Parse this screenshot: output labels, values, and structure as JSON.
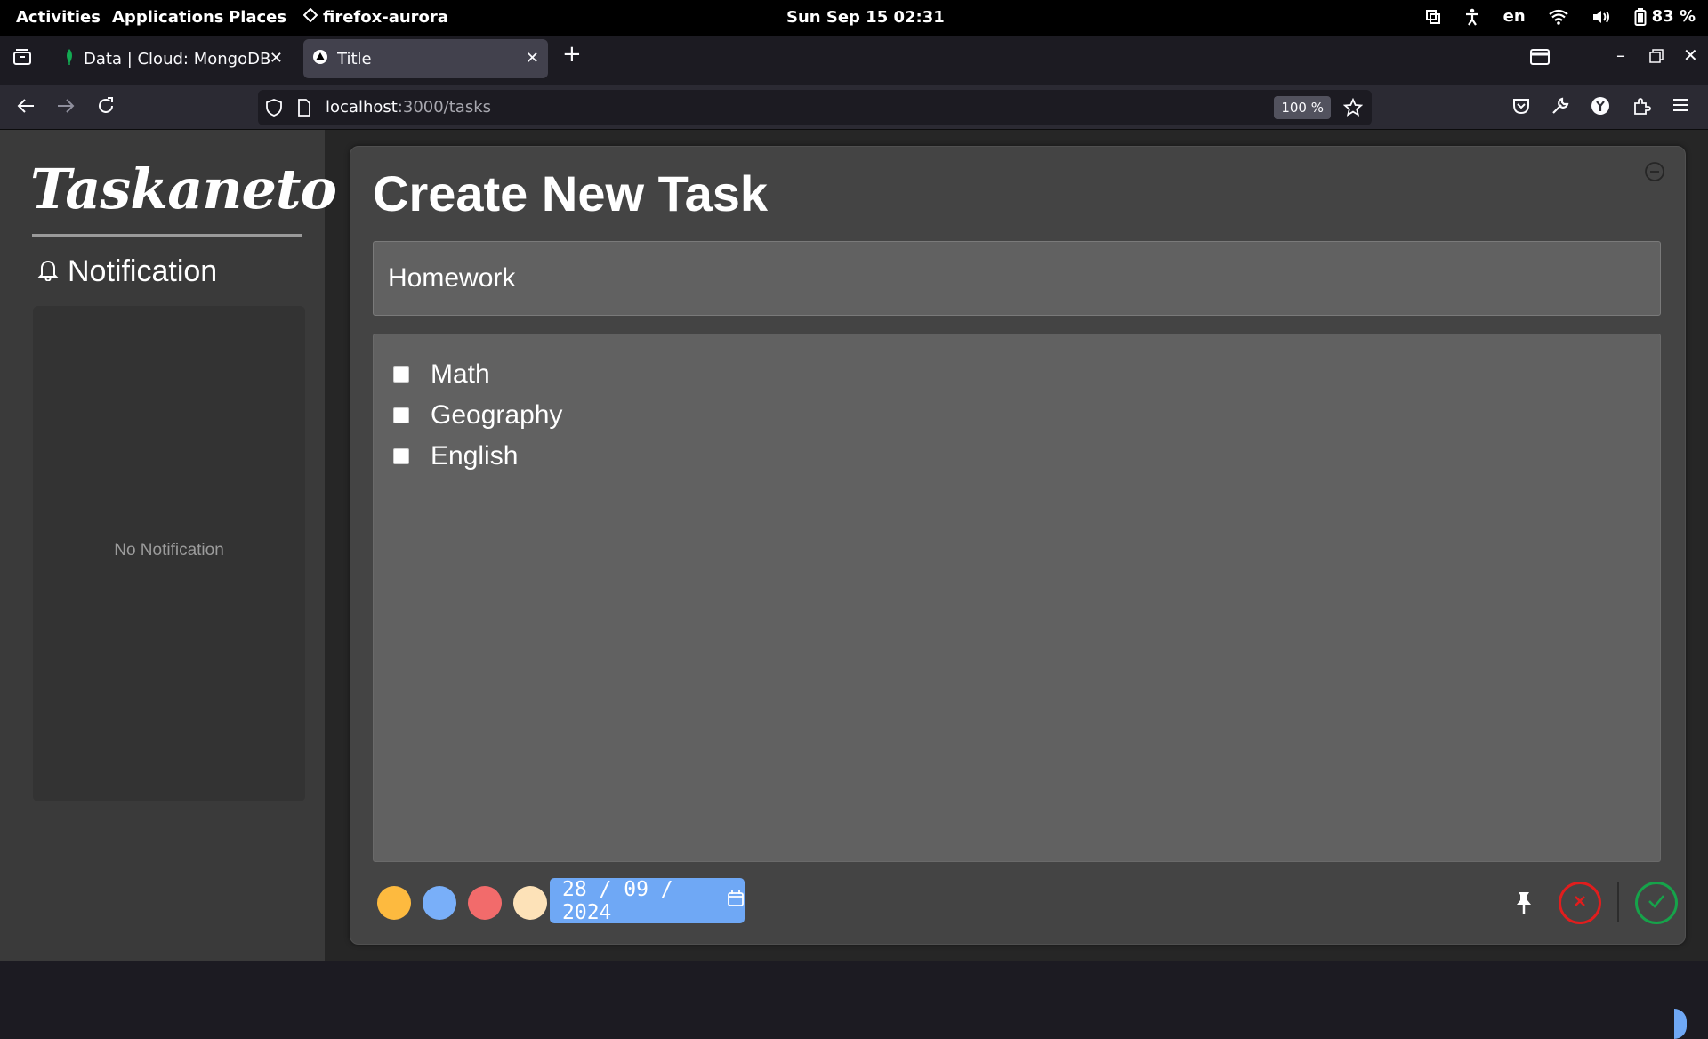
{
  "system_bar": {
    "activities": "Activities",
    "applications": "Applications",
    "places": "Places",
    "app_name": "firefox-aurora",
    "datetime": "Sun Sep 15  02:31",
    "language": "en",
    "battery": "83 %"
  },
  "browser": {
    "tabs": [
      {
        "title": "Data | Cloud: MongoDB Cl",
        "active": false
      },
      {
        "title": "Title",
        "active": true
      }
    ],
    "url_host": "localhost",
    "url_path": ":3000/tasks",
    "zoom": "100 %"
  },
  "sidebar": {
    "logo": "Taskaneto",
    "notification_heading": "Notification",
    "empty_text": "No Notification"
  },
  "task_form": {
    "heading": "Create New Task",
    "title_value": "Homework",
    "checklist": [
      {
        "label": "Math",
        "checked": false
      },
      {
        "label": "Geography",
        "checked": false
      },
      {
        "label": "English",
        "checked": false
      }
    ],
    "colors": [
      "#fdba3f",
      "#79aff9",
      "#f26b6b",
      "#fde2b8"
    ],
    "due_date": "28 / 09 / 2024"
  },
  "colors": {
    "cancel": "#e11d1d",
    "confirm": "#16a34a",
    "date_accent": "#6fa8f5"
  }
}
